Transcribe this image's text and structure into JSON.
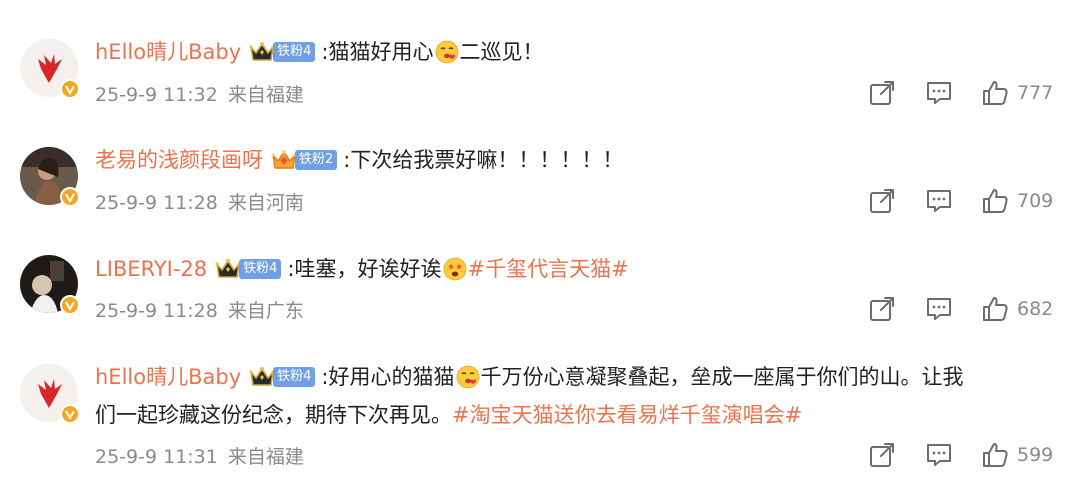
{
  "comments": [
    {
      "username": "hEllo晴儿Baby",
      "fan_badge": "铁粉4",
      "text_before": ":猫猫好用心",
      "emoji": "love-face",
      "text_after": "二巡见！",
      "time": "25-9-9 11:32",
      "location": "来自福建",
      "likes": "777"
    },
    {
      "username": "老易的浅颜段画呀",
      "fan_badge": "铁粉2",
      "text_before": ":下次给我票好嘛！！！！！！",
      "time": "25-9-9 11:28",
      "location": "来自河南",
      "likes": "709"
    },
    {
      "username": "LIBERYI-28",
      "fan_badge": "铁粉4",
      "text_before": ":哇塞，好诶好诶",
      "emoji": "star-struck-face",
      "topic": "#千玺代言天猫#",
      "time": "25-9-9 11:28",
      "location": "来自广东",
      "likes": "682"
    },
    {
      "username": "hEllo晴儿Baby",
      "fan_badge": "铁粉4",
      "text_before": ":好用心的猫猫",
      "emoji": "love-face",
      "text_after": "千万份心意凝聚叠起，垒成一座属于你们的山。让我",
      "line2": "们一起珍藏这份纪念，期待下次再见。",
      "topic": "#淘宝天猫送你去看易烊千玺演唱会#",
      "time": "25-9-9 11:31",
      "location": "来自福建",
      "likes": "599"
    }
  ],
  "colors": {
    "username": "#eb7350",
    "topic": "#eb7350",
    "meta": "#8a8a8a",
    "fan_badge_bg": "#6fa0e6",
    "verified_badge": "#f5a623"
  }
}
